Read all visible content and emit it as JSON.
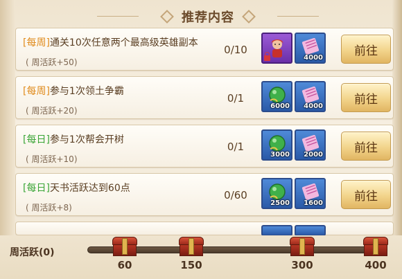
{
  "header": {
    "title": "推荐内容"
  },
  "tasks": [
    {
      "tag": "[每周]",
      "tag_type": "week",
      "text": "通关10次任意两个最高级英雄副本",
      "bonus": "( 周活跃+50)",
      "progress": "0/10",
      "rewards": [
        {
          "icon": "hero-portrait-icon",
          "style": "purple",
          "qty": "",
          "locked": true
        },
        {
          "icon": "scroll-icon",
          "style": "blue",
          "qty": "4000",
          "locked": false
        }
      ],
      "button": "前往"
    },
    {
      "tag": "[每周]",
      "tag_type": "week",
      "text": "参与1次领土争霸",
      "bonus": "( 周活跃+20)",
      "progress": "0/1",
      "rewards": [
        {
          "icon": "green-orb-icon",
          "style": "blue",
          "qty": "6000",
          "locked": false
        },
        {
          "icon": "scroll-icon",
          "style": "blue",
          "qty": "4000",
          "locked": false
        }
      ],
      "button": "前往"
    },
    {
      "tag": "[每日]",
      "tag_type": "day",
      "text": "参与1次帮会开树",
      "bonus": "( 周活跃+10)",
      "progress": "0/1",
      "rewards": [
        {
          "icon": "green-orb-icon",
          "style": "blue",
          "qty": "3000",
          "locked": false
        },
        {
          "icon": "scroll-icon",
          "style": "blue",
          "qty": "2000",
          "locked": false
        }
      ],
      "button": "前往"
    },
    {
      "tag": "[每日]",
      "tag_type": "day",
      "text": "天书活跃达到60点",
      "bonus": "( 周活跃+8)",
      "progress": "0/60",
      "rewards": [
        {
          "icon": "green-orb-icon",
          "style": "blue",
          "qty": "2500",
          "locked": false
        },
        {
          "icon": "scroll-icon",
          "style": "blue",
          "qty": "1600",
          "locked": false
        }
      ],
      "button": "前往"
    }
  ],
  "footer": {
    "label": "周活跃(0)",
    "milestones": [
      "60",
      "150",
      "300",
      "400"
    ]
  },
  "colors": {
    "week_tag": "#e08b1c",
    "day_tag": "#3aa536",
    "text": "#5a3e22"
  }
}
